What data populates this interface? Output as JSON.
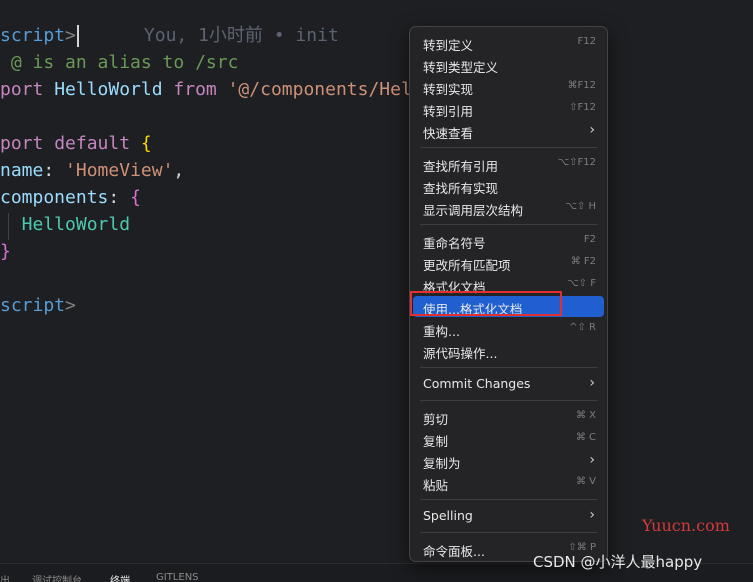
{
  "editor": {
    "lines": [
      {
        "segments": [
          {
            "t": "script",
            "c": "#569cd6"
          },
          {
            "t": ">",
            "c": "#808080"
          }
        ],
        "cursor": true,
        "blame": "You, 1小时前 • init"
      },
      {
        "segments": [
          {
            "t": " @ is an alias to /src",
            "c": "#6a9955"
          }
        ]
      },
      {
        "segments": [
          {
            "t": "port ",
            "c": "#c586c0"
          },
          {
            "t": "HelloWorld ",
            "c": "#9cdcfe"
          },
          {
            "t": "from ",
            "c": "#c586c0"
          },
          {
            "t": "'@/components/Hel",
            "c": "#ce9178"
          }
        ]
      },
      {
        "segments": []
      },
      {
        "segments": [
          {
            "t": "port ",
            "c": "#c586c0"
          },
          {
            "t": "default ",
            "c": "#c586c0"
          },
          {
            "t": "{",
            "c": "#ffd700"
          }
        ]
      },
      {
        "segments": [
          {
            "t": "name",
            "c": "#9cdcfe"
          },
          {
            "t": ": ",
            "c": "#d4d4d4"
          },
          {
            "t": "'HomeView'",
            "c": "#ce9178"
          },
          {
            "t": ",",
            "c": "#d4d4d4"
          }
        ]
      },
      {
        "segments": [
          {
            "t": "components",
            "c": "#9cdcfe"
          },
          {
            "t": ": ",
            "c": "#d4d4d4"
          },
          {
            "t": "{",
            "c": "#da70d6"
          }
        ]
      },
      {
        "segments": [
          {
            "t": "  HelloWorld",
            "c": "#4ec9b0"
          }
        ]
      },
      {
        "segments": [
          {
            "t": "}",
            "c": "#da70d6"
          }
        ]
      },
      {
        "segments": []
      },
      {
        "segments": [
          {
            "t": "script",
            "c": "#569cd6"
          },
          {
            "t": ">",
            "c": "#808080"
          }
        ]
      }
    ]
  },
  "context_menu": {
    "items": [
      {
        "label": "转到定义",
        "shortcut": "F12"
      },
      {
        "label": "转到类型定义",
        "shortcut": ""
      },
      {
        "label": "转到实现",
        "shortcut": "⌘F12"
      },
      {
        "label": "转到引用",
        "shortcut": "⇧F12"
      },
      {
        "label": "快速查看",
        "shortcut": "",
        "submenu": true
      },
      {
        "sep": true
      },
      {
        "label": "查找所有引用",
        "shortcut": "⌥⇧F12"
      },
      {
        "label": "查找所有实现",
        "shortcut": ""
      },
      {
        "label": "显示调用层次结构",
        "shortcut": "⌥⇧ H"
      },
      {
        "sep": true
      },
      {
        "label": "重命名符号",
        "shortcut": "F2"
      },
      {
        "label": "更改所有匹配项",
        "shortcut": "⌘ F2"
      },
      {
        "label": "格式化文档",
        "shortcut": "⌥⇧ F"
      },
      {
        "label": "使用...格式化文档",
        "shortcut": "",
        "highlighted": true
      },
      {
        "label": "重构...",
        "shortcut": "^⇧ R"
      },
      {
        "label": "源代码操作...",
        "shortcut": ""
      },
      {
        "sep": true
      },
      {
        "label": "Commit Changes",
        "shortcut": "",
        "submenu": true
      },
      {
        "sep": true
      },
      {
        "label": "剪切",
        "shortcut": "⌘ X"
      },
      {
        "label": "复制",
        "shortcut": "⌘ C"
      },
      {
        "label": "复制为",
        "shortcut": "",
        "submenu": true
      },
      {
        "label": "粘贴",
        "shortcut": "⌘ V"
      },
      {
        "sep": true
      },
      {
        "label": "Spelling",
        "shortcut": "",
        "submenu": true
      },
      {
        "sep": true
      },
      {
        "label": "命令面板...",
        "shortcut": "⇧⌘ P"
      }
    ]
  },
  "bottom_panel": {
    "tabs": [
      {
        "label": "出",
        "active": false
      },
      {
        "label": "调试控制台",
        "active": false
      },
      {
        "label": "终端",
        "active": true
      },
      {
        "label": "GITLENS",
        "active": false
      }
    ]
  },
  "watermarks": {
    "site": "Yuucn.com",
    "csdn": "CSDN @小洋人最happy"
  },
  "colors": {
    "highlight": "#1f5fd0",
    "annotation_box": "#e03030"
  }
}
